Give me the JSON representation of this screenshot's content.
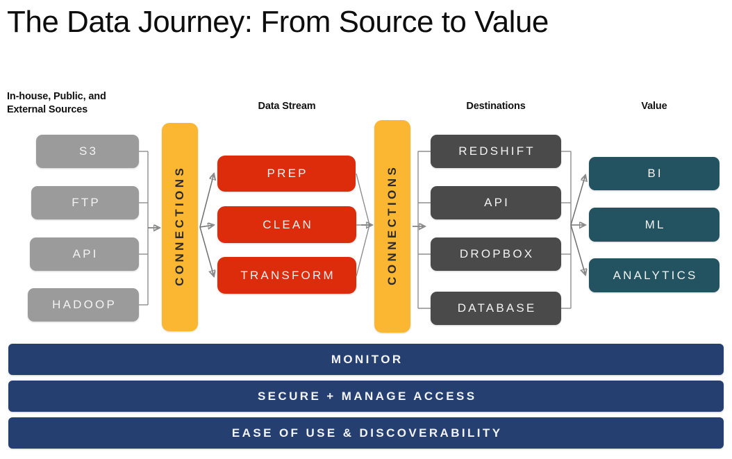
{
  "title": "The Data Journey: From Source to Value",
  "columns": {
    "sources": {
      "header_line1": "In-house, Public, and",
      "header_line2": "External Sources"
    },
    "stream": {
      "header": "Data Stream"
    },
    "destinations": {
      "header": "Destinations"
    },
    "value": {
      "header": "Value"
    }
  },
  "sources": [
    {
      "label": "S3"
    },
    {
      "label": "FTP"
    },
    {
      "label": "API"
    },
    {
      "label": "HADOOP"
    }
  ],
  "connections": [
    {
      "label": "CONNECTIONS"
    },
    {
      "label": "CONNECTIONS"
    }
  ],
  "stream_stages": [
    {
      "label": "PREP"
    },
    {
      "label": "CLEAN"
    },
    {
      "label": "TRANSFORM"
    }
  ],
  "destinations": [
    {
      "label": "REDSHIFT"
    },
    {
      "label": "API"
    },
    {
      "label": "DROPBOX"
    },
    {
      "label": "DATABASE"
    }
  ],
  "value_outputs": [
    {
      "label": "BI"
    },
    {
      "label": "ML"
    },
    {
      "label": "ANALYTICS"
    }
  ],
  "foundation_bars": [
    {
      "label": "MONITOR"
    },
    {
      "label": "SECURE + MANAGE ACCESS"
    },
    {
      "label": "EASE OF USE & DISCOVERABILITY"
    }
  ],
  "colors": {
    "background": "#ffffff",
    "title_text": "#0d0d0d",
    "source_box": "#9b9b9b",
    "connections_pillar": "#fbb731",
    "stream_box": "#dd2c0b",
    "destination_box": "#4a4a4a",
    "value_box": "#235361",
    "foundation_bar": "#254070",
    "connector_line": "#8d8d8d",
    "box_label_text": "#f3f3f3"
  }
}
